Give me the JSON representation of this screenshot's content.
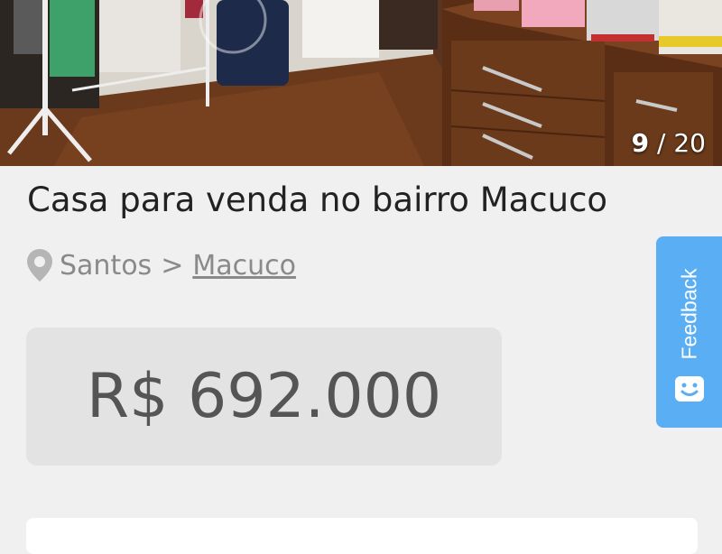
{
  "gallery": {
    "current": "9",
    "separator": "/",
    "total": "20"
  },
  "listing": {
    "title": "Casa para venda no bairro Macuco",
    "city": "Santos",
    "breadcrumb_sep": ">",
    "neighborhood": "Macuco",
    "price": "R$ 692.000"
  },
  "feedback": {
    "label": "Feedback",
    "icon": "smiley-icon"
  },
  "colors": {
    "feedback_bg": "#5aaef3",
    "price_bg": "#e3e3e3",
    "page_bg": "#f0f0f0"
  }
}
